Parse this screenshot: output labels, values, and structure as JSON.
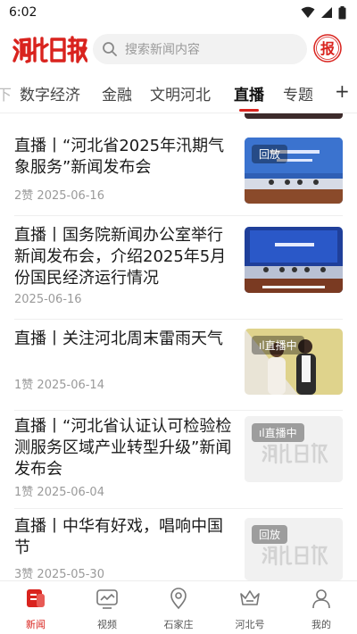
{
  "status": {
    "time": "6:02"
  },
  "header": {
    "logo_text": "河北日报",
    "search_placeholder": "搜索新闻内容",
    "paper_label": "报"
  },
  "tabs": [
    {
      "label": "数字经济"
    },
    {
      "label": "金融"
    },
    {
      "label": "文明河北"
    },
    {
      "label": "直播",
      "active": true
    },
    {
      "label": "专题"
    }
  ],
  "tabs_more": "+",
  "articles": [
    {
      "title": "直播丨“河北省2025年汛期气象服务”新闻发布会",
      "likes": "2赞",
      "date": "2025-06-16",
      "badge": "回放"
    },
    {
      "title": "直播丨国务院新闻办公室举行新闻发布会，介绍2025年5月份国民经济运行情况",
      "likes": "",
      "date": "2025-06-16",
      "badge": ""
    },
    {
      "title": "直播丨关注河北周末雷雨天气",
      "likes": "1赞",
      "date": "2025-06-14",
      "badge": "直播中"
    },
    {
      "title": "直播丨“河北省认证认可检验检测服务区域产业转型升级”新闻发布会",
      "likes": "1赞",
      "date": "2025-06-04",
      "badge": "直播中"
    },
    {
      "title": "直播丨中华有好戏，唱响中国节",
      "likes": "3赞",
      "date": "2025-05-30",
      "badge": "回放"
    }
  ],
  "bottom_nav": [
    {
      "label": "新闻",
      "icon": "news-icon",
      "active": true
    },
    {
      "label": "视频",
      "icon": "video-icon"
    },
    {
      "label": "石家庄",
      "icon": "location-icon"
    },
    {
      "label": "河北号",
      "icon": "crown-icon"
    },
    {
      "label": "我的",
      "icon": "user-icon"
    }
  ],
  "colors": {
    "accent": "#d9231e"
  }
}
